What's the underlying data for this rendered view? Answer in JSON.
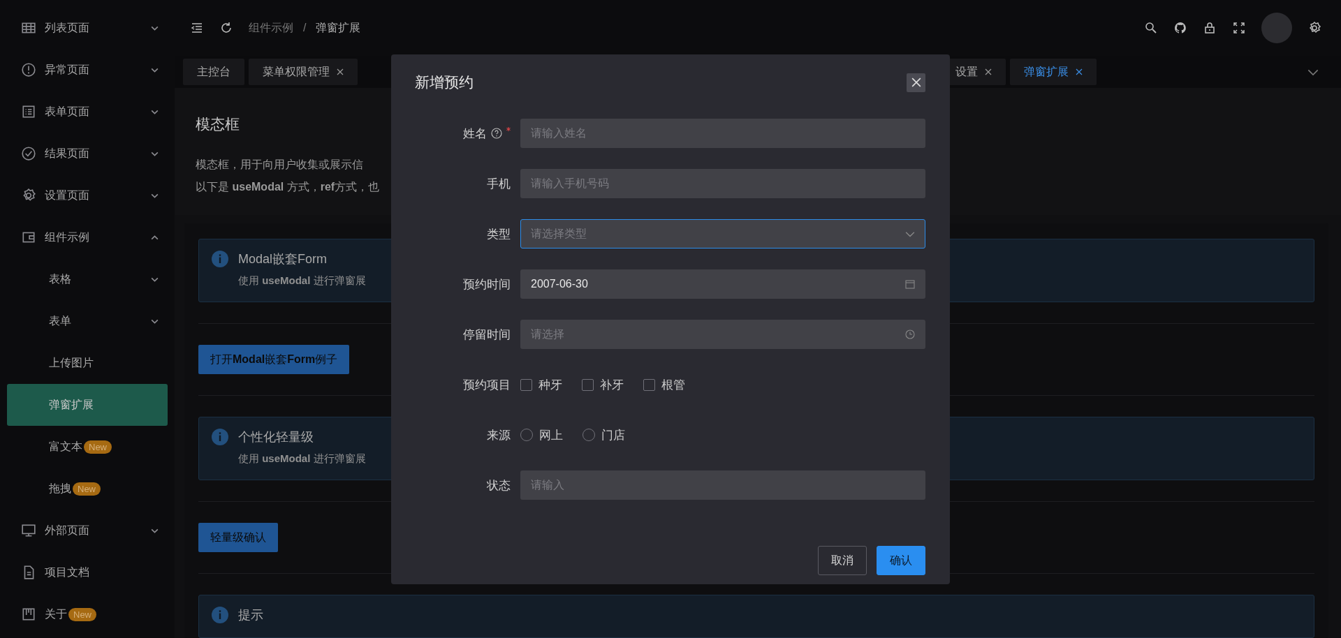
{
  "sidebar": {
    "items": [
      {
        "label": "列表页面",
        "expanded": false
      },
      {
        "label": "异常页面",
        "expanded": false
      },
      {
        "label": "表单页面",
        "expanded": false
      },
      {
        "label": "结果页面",
        "expanded": false
      },
      {
        "label": "设置页面",
        "expanded": false
      },
      {
        "label": "组件示例",
        "expanded": true,
        "children": [
          {
            "label": "表格",
            "expanded": false,
            "selected": false
          },
          {
            "label": "表单",
            "expanded": false,
            "selected": false
          },
          {
            "label": "上传图片",
            "selected": false
          },
          {
            "label": "弹窗扩展",
            "selected": true
          },
          {
            "label": "富文本",
            "badge": "New",
            "selected": false
          },
          {
            "label": "拖拽",
            "badge": "New",
            "selected": false
          }
        ]
      },
      {
        "label": "外部页面",
        "expanded": false
      },
      {
        "label": "项目文档"
      },
      {
        "label": "关于",
        "badge": "New"
      }
    ]
  },
  "header": {
    "breadcrumb": [
      "组件示例",
      "/",
      "弹窗扩展"
    ]
  },
  "tabs": [
    {
      "label": "主控台",
      "closable": false,
      "selected": false
    },
    {
      "label": "菜单权限管理",
      "closable": true,
      "selected": false
    },
    {
      "label": "设置",
      "closable": true,
      "selected": false
    },
    {
      "label": "弹窗扩展",
      "closable": true,
      "selected": true
    }
  ],
  "page": {
    "title": "模态框",
    "description": [
      "模态框，用于向用户收集或展示信",
      "以下是 **useModal** 方式，**ref**方式，也"
    ],
    "sections": [
      {
        "kind": "alert",
        "title": "Modal嵌套Form",
        "text": "使用 **useModal** 进行弹窗展"
      },
      {
        "kind": "button",
        "label": "打开**Modal**嵌套**Form**例子"
      },
      {
        "kind": "alert",
        "title": "个性化轻量级",
        "text": "使用 **useModal** 进行弹窗展"
      },
      {
        "kind": "button",
        "label": "轻量级确认"
      },
      {
        "kind": "alert",
        "title": "提示"
      }
    ]
  },
  "modal": {
    "title": "新增预约",
    "fields": [
      {
        "kind": "input",
        "label": "姓名",
        "required": true,
        "help": true,
        "placeholder": "请输入姓名"
      },
      {
        "kind": "input",
        "label": "手机",
        "placeholder": "请输入手机号码"
      },
      {
        "kind": "select",
        "label": "类型",
        "placeholder": "请选择类型",
        "focused": true
      },
      {
        "kind": "date",
        "label": "预约时间",
        "value": "2007-06-30"
      },
      {
        "kind": "time",
        "label": "停留时间",
        "placeholder": "请选择"
      },
      {
        "kind": "checkbox",
        "label": "预约项目",
        "options": [
          {
            "label": "种牙",
            "checked": false
          },
          {
            "label": "补牙",
            "checked": false
          },
          {
            "label": "根管",
            "checked": false
          }
        ]
      },
      {
        "kind": "radio",
        "label": "来源",
        "options": [
          {
            "label": "网上",
            "selected": false
          },
          {
            "label": "门店",
            "selected": false
          }
        ]
      },
      {
        "kind": "input",
        "label": "状态",
        "placeholder": "请输入"
      }
    ],
    "buttons": [
      {
        "label": "取消",
        "kind": "default"
      },
      {
        "label": "确认",
        "kind": "primary"
      }
    ]
  }
}
